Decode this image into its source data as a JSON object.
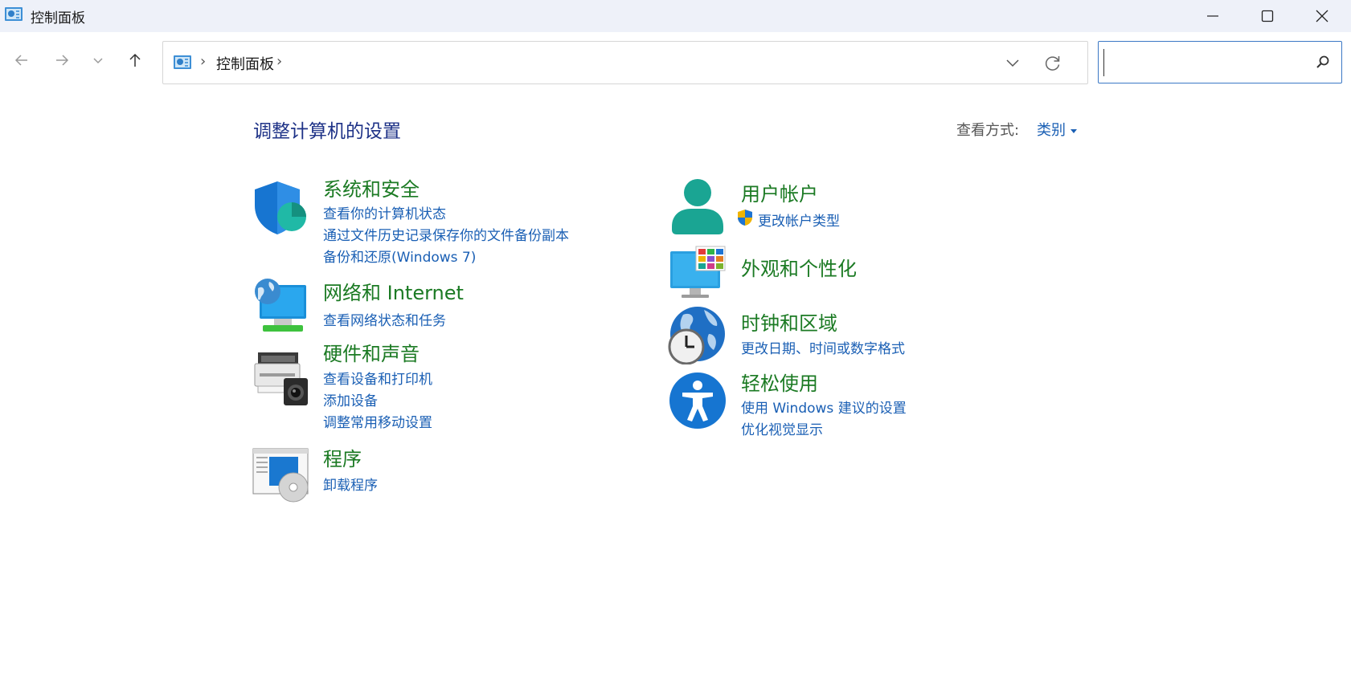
{
  "window": {
    "title": "控制面板"
  },
  "address": {
    "breadcrumb": "控制面板",
    "separator": "›"
  },
  "search": {
    "placeholder": "",
    "value": ""
  },
  "header": {
    "title": "调整计算机的设置",
    "view_by_label": "查看方式:",
    "view_by_value": "类别"
  },
  "categories": [
    {
      "title": "系统和安全",
      "icon": "shield-icon",
      "links": [
        "查看你的计算机状态",
        "通过文件历史记录保存你的文件备份副本",
        "备份和还原(Windows 7)"
      ]
    },
    {
      "title": "网络和 Internet",
      "icon": "network-icon",
      "links": [
        "查看网络状态和任务"
      ]
    },
    {
      "title": "硬件和声音",
      "icon": "printer-icon",
      "links": [
        "查看设备和打印机",
        "添加设备",
        "调整常用移动设置"
      ]
    },
    {
      "title": "程序",
      "icon": "programs-icon",
      "links": [
        "卸载程序"
      ]
    },
    {
      "title": "用户帐户",
      "icon": "user-icon",
      "links": [
        "更改帐户类型"
      ]
    },
    {
      "title": "外观和个性化",
      "icon": "appearance-icon",
      "links": []
    },
    {
      "title": "时钟和区域",
      "icon": "clock-globe-icon",
      "links": [
        "更改日期、时间或数字格式"
      ]
    },
    {
      "title": "轻松使用",
      "icon": "accessibility-icon",
      "links": [
        "使用 Windows 建议的设置",
        "优化视觉显示"
      ]
    }
  ],
  "colors": {
    "title_bar": "#eef1f9",
    "category_title": "#1b7a23",
    "link": "#1a5fb4",
    "page_title": "#1e3287"
  }
}
